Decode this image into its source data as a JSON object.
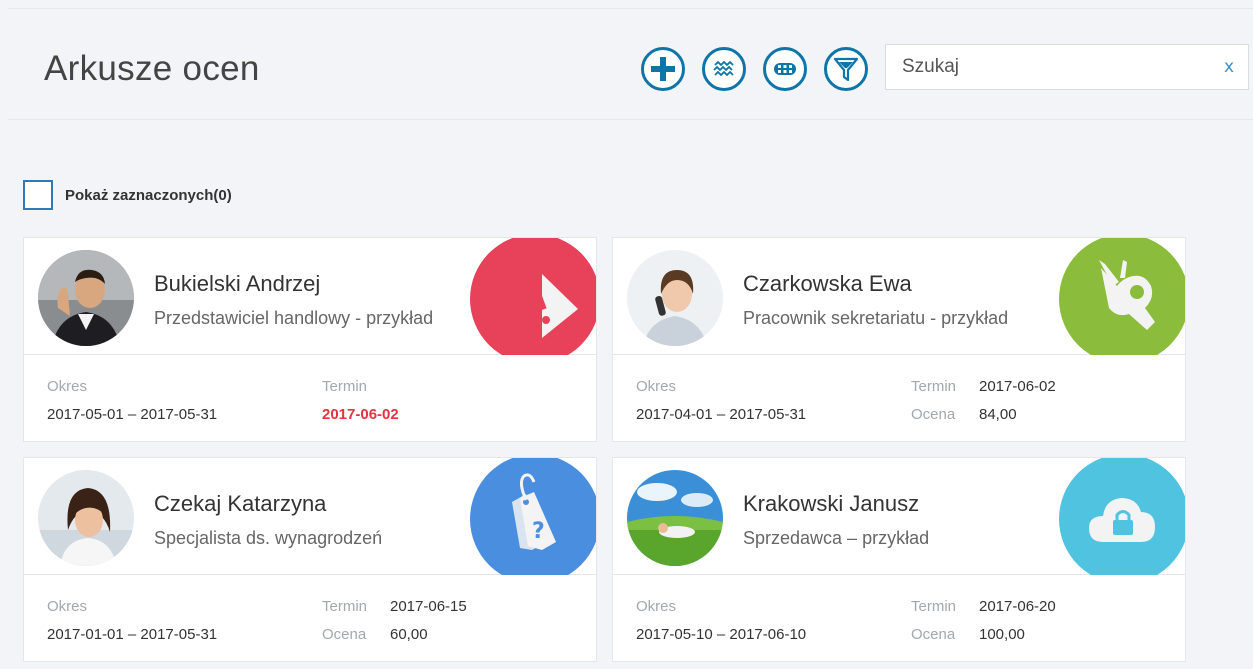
{
  "page": {
    "title": "Arkusze ocen"
  },
  "toolbar": {
    "buttons": [
      {
        "name": "add-button",
        "icon": "plus-icon"
      },
      {
        "name": "rates-button",
        "icon": "waves-icon"
      },
      {
        "name": "more-button",
        "icon": "dots-icon"
      },
      {
        "name": "filter-button",
        "icon": "filter-icon"
      }
    ],
    "accent_color": "#0e75a8"
  },
  "search": {
    "placeholder": "Szukaj",
    "value": "",
    "clear_label": "x"
  },
  "selection": {
    "label": "Pokaż zaznaczonych(0)"
  },
  "labels": {
    "period": "Okres",
    "deadline": "Termin",
    "score": "Ocena"
  },
  "cards": [
    {
      "name": "Bukielski Andrzej",
      "role": "Przedstawiciel handlowy - przykład",
      "period": "2017-05-01 – 2017-05-31",
      "deadline": "2017-06-02",
      "deadline_overdue": true,
      "score": "",
      "badge_icon": "warning-icon",
      "badge_color": "#e8415a"
    },
    {
      "name": "Czarkowska Ewa",
      "role": "Pracownik sekretariatu - przykład",
      "period": "2017-04-01 – 2017-05-31",
      "deadline": "2017-06-02",
      "deadline_overdue": false,
      "score": "84,00",
      "badge_icon": "ok-hand-icon",
      "badge_color": "#8cbc3c"
    },
    {
      "name": "Czekaj Katarzyna",
      "role": "Specjalista ds. wynagrodzeń",
      "period": "2017-01-01 – 2017-05-31",
      "deadline": "2017-06-15",
      "deadline_overdue": false,
      "score": "60,00",
      "badge_icon": "question-tag-icon",
      "badge_color": "#4a8ee0"
    },
    {
      "name": "Krakowski Janusz",
      "role": "Sprzedawca – przykład",
      "period": "2017-05-10 – 2017-06-10",
      "deadline": "2017-06-20",
      "deadline_overdue": false,
      "score": "100,00",
      "badge_icon": "cloud-lock-icon",
      "badge_color": "#4fc3df"
    }
  ]
}
